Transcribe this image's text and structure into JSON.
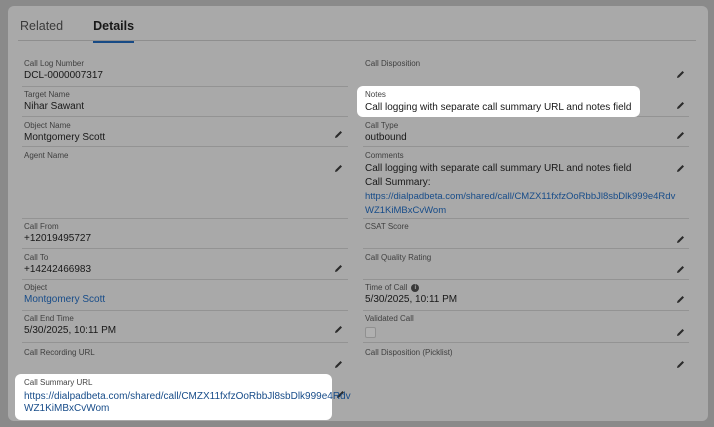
{
  "tabs": [
    {
      "label": "Related"
    },
    {
      "label": "Details"
    }
  ],
  "left_fields": {
    "call_log_number": {
      "label": "Call Log Number",
      "value": "DCL-0000007317"
    },
    "target_name": {
      "label": "Target Name",
      "value": "Nihar Sawant"
    },
    "object_name": {
      "label": "Object Name",
      "value": "Montgomery Scott"
    },
    "agent_name": {
      "label": "Agent Name",
      "value": ""
    },
    "call_from": {
      "label": "Call From",
      "value": "+12019495727"
    },
    "call_to": {
      "label": "Call To",
      "value": "+14242466983"
    },
    "object": {
      "label": "Object",
      "value": "Montgomery Scott"
    },
    "call_end_time": {
      "label": "Call End Time",
      "value": "5/30/2025, 10:11 PM"
    },
    "call_recording_url": {
      "label": "Call Recording URL",
      "value": ""
    },
    "call_summary_url": {
      "label": "Call Summary URL",
      "value_line1": "https://dialpadbeta.com/shared/call/CMZX11fxfzOoRbbJl8sbDlk999e4Rdv",
      "value_line2": "WZ1KiMBxCvWom"
    }
  },
  "right_fields": {
    "call_disposition": {
      "label": "Call Disposition",
      "value": ""
    },
    "notes": {
      "label": "Notes",
      "value": "Call logging with separate call summary URL and notes field"
    },
    "call_type": {
      "label": "Call Type",
      "value": "outbound"
    },
    "comments": {
      "label": "Comments",
      "line1": "Call logging with separate call summary URL and notes field",
      "line2": "Call Summary:",
      "line3": "https://dialpadbeta.com/shared/call/CMZX11fxfzOoRbbJl8sbDlk999e4Rdv",
      "line4": "WZ1KiMBxCvWom"
    },
    "csat_score": {
      "label": "CSAT Score",
      "value": ""
    },
    "call_quality_rating": {
      "label": "Call Quality Rating",
      "value": ""
    },
    "time_of_call": {
      "label": "Time of Call",
      "value": "5/30/2025, 10:11 PM"
    },
    "validated_call": {
      "label": "Validated Call",
      "checked": false
    },
    "call_disposition_picklist": {
      "label": "Call Disposition (Picklist)",
      "value": ""
    }
  },
  "colors": {
    "accent": "#174a85",
    "link": "#174c89",
    "highlight_bg": "#ffffff",
    "overlay": "#a9a9a9"
  }
}
